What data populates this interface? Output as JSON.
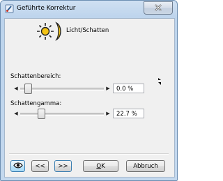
{
  "window": {
    "title": "Geführte Korrektur",
    "icons": {
      "app": "brush-icon",
      "close": "close-icon"
    }
  },
  "mode": {
    "label": "Licht/Schatten",
    "icon": "sun-moon-icon"
  },
  "schattenbereich": {
    "label": "Schattenbereich:",
    "value": "0.0 %",
    "slider_fraction": 0.0
  },
  "schattengamma": {
    "label": "Schattengamma:",
    "value": "22.7 %",
    "slider_fraction": 0.227
  },
  "buttons": {
    "preview_icon": "eye-icon",
    "prev": "<<",
    "next": ">>",
    "ok_underlined": "O",
    "ok_rest": "K",
    "cancel": "Abbruch"
  },
  "colors": {
    "sun": "#f3c315",
    "moon": "#f3c315",
    "title_bar": "#bcd3ec",
    "close_x": "#ffffff"
  }
}
